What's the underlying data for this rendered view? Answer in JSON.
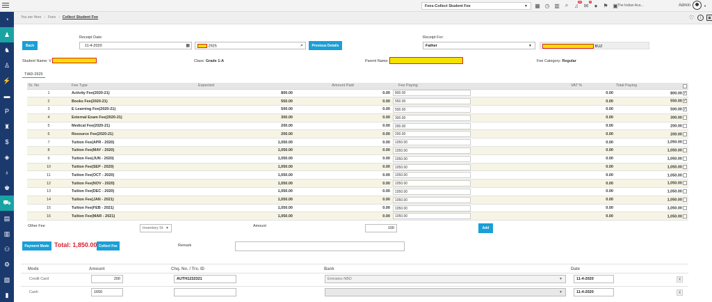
{
  "topbar": {
    "page_select": "Fees-Collect Student Fee",
    "school_name": "The Indian Aca...",
    "user_label": "Admin",
    "badges": {
      "notifications": "88",
      "messages": "6"
    }
  },
  "breadcrumb": {
    "home": "You are Here",
    "section": "Fees",
    "current": "Collect Student Fee"
  },
  "form": {
    "back_label": "Back",
    "receipt_date_label": "Receipt Date:",
    "receipt_date_value": "11-4-2020",
    "student_id_suffix": "2925",
    "previous_details_label": "Previous Details",
    "receipt_for_label": "Receipt For:",
    "receipt_for_value": "Father",
    "parent_code_suffix": "BUZ",
    "student_name_label": "Student Name: V",
    "class_label": "Class:",
    "class_value": "Grade 1-A",
    "parent_name_label": "Parent Name:",
    "fee_category_label": "Fee Category:",
    "fee_category_value": "Regular"
  },
  "tab": "TIAD-2925",
  "table": {
    "headers": [
      "Sr. No",
      "Fee Type",
      "Expected",
      "Amount Paid",
      "Fee Paying",
      "VAT %",
      "Total Paying"
    ],
    "rows": [
      {
        "sr": "1",
        "type": "Activity Fee(2020-21)",
        "expected": "800.00",
        "paid": "0.00",
        "paying": "800.00",
        "vat": "0.00",
        "total": "800.00",
        "checked": true
      },
      {
        "sr": "2",
        "type": "Books Fee(2020-21)",
        "expected": "550.00",
        "paid": "0.00",
        "paying": "550.00",
        "vat": "0.00",
        "total": "550.00",
        "checked": true
      },
      {
        "sr": "3",
        "type": "E Learning Fee(2020-21)",
        "expected": "500.00",
        "paid": "0.00",
        "paying": "500.00",
        "vat": "0.00",
        "total": "500.00",
        "checked": true
      },
      {
        "sr": "4",
        "type": "External Exam Fee(2020-21)",
        "expected": "300.00",
        "paid": "0.00",
        "paying": "300.00",
        "vat": "0.00",
        "total": "300.00",
        "checked": false
      },
      {
        "sr": "5",
        "type": "Medical Fee(2020-21)",
        "expected": "200.00",
        "paid": "0.00",
        "paying": "200.00",
        "vat": "0.00",
        "total": "200.00",
        "checked": false
      },
      {
        "sr": "6",
        "type": "Resource Fee(2020-21)",
        "expected": "200.00",
        "paid": "0.00",
        "paying": "200.00",
        "vat": "0.00",
        "total": "200.00",
        "checked": false
      },
      {
        "sr": "7",
        "type": "Tuition Fee(APR - 2020)",
        "expected": "1,050.00",
        "paid": "0.00",
        "paying": "1050.00",
        "vat": "0.00",
        "total": "1,050.00",
        "checked": false
      },
      {
        "sr": "8",
        "type": "Tuition Fee(MAY - 2020)",
        "expected": "1,050.00",
        "paid": "0.00",
        "paying": "1050.00",
        "vat": "0.00",
        "total": "1,050.00",
        "checked": false
      },
      {
        "sr": "9",
        "type": "Tuition Fee(JUN - 2020)",
        "expected": "1,050.00",
        "paid": "0.00",
        "paying": "1050.00",
        "vat": "0.00",
        "total": "1,050.00",
        "checked": false
      },
      {
        "sr": "10",
        "type": "Tuition Fee(SEP - 2020)",
        "expected": "1,050.00",
        "paid": "0.00",
        "paying": "1050.00",
        "vat": "0.00",
        "total": "1,050.00",
        "checked": false
      },
      {
        "sr": "11",
        "type": "Tuition Fee(OCT - 2020)",
        "expected": "1,050.00",
        "paid": "0.00",
        "paying": "1050.00",
        "vat": "0.00",
        "total": "1,050.00",
        "checked": false
      },
      {
        "sr": "12",
        "type": "Tuition Fee(NOV - 2020)",
        "expected": "1,050.00",
        "paid": "0.00",
        "paying": "1050.00",
        "vat": "0.00",
        "total": "1,050.00",
        "checked": false
      },
      {
        "sr": "13",
        "type": "Tuition Fee(DEC - 2020)",
        "expected": "1,050.00",
        "paid": "0.00",
        "paying": "1050.00",
        "vat": "0.00",
        "total": "1,050.00",
        "checked": false
      },
      {
        "sr": "14",
        "type": "Tuition Fee(JAN - 2021)",
        "expected": "1,050.00",
        "paid": "0.00",
        "paying": "1050.00",
        "vat": "0.00",
        "total": "1,050.00",
        "checked": false
      },
      {
        "sr": "15",
        "type": "Tuition Fee(FEB - 2021)",
        "expected": "1,050.00",
        "paid": "0.00",
        "paying": "1050.00",
        "vat": "0.00",
        "total": "1,050.00",
        "checked": false
      },
      {
        "sr": "16",
        "type": "Tuition Fee(MAR - 2021)",
        "expected": "1,050.00",
        "paid": "0.00",
        "paying": "1050.00",
        "vat": "0.00",
        "total": "1,050.00",
        "checked": false
      }
    ]
  },
  "other_fee": {
    "label": "Other Fee",
    "select_value": "Inventory St",
    "amount_label": "Amount",
    "amount_value": "100",
    "add_label": "Add"
  },
  "summary": {
    "payment_mode_label": "Payment Mode",
    "total_label": "Total: 1,850.00",
    "collect_label": "Collect Fee",
    "remark_label": "Remark"
  },
  "payments": {
    "headers": [
      "Mode",
      "Amount",
      "Chq. No. / Trx. ID",
      "Bank",
      "Date"
    ],
    "rows": [
      {
        "mode": "Credit Card",
        "amount": "200",
        "trx": "AUTH1232321",
        "bank": "Emirates NBD",
        "date": "11-4-2020",
        "remove": "X"
      },
      {
        "mode": "Cash",
        "amount": "1650",
        "trx": "",
        "bank": "",
        "date": "11-4-2020",
        "remove": "X"
      }
    ]
  },
  "colors": {
    "sidebar": "#1a3a6e",
    "accent": "#1a9fd6",
    "total": "#d9232d",
    "row_alt": "#f6f4e4"
  }
}
